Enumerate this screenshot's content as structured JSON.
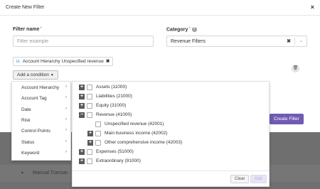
{
  "modal": {
    "title": "Create New Filter",
    "close": "×"
  },
  "form": {
    "filter_name_label": "Filter name",
    "filter_name_placeholder": "Filter example",
    "category_label": "Category",
    "category_value": "Revenue Filters",
    "required_mark": "*",
    "help_icon": "?"
  },
  "chip": {
    "operator": "is",
    "label": "Account Hierarchy Unspecified revenue",
    "remove": "✖"
  },
  "add_condition": "Add a condition",
  "create_button": "Create Filter",
  "condition_menu": [
    {
      "label": "Account Hierarchy"
    },
    {
      "label": "Account Tag"
    },
    {
      "label": "Date"
    },
    {
      "label": "Risk"
    },
    {
      "label": "Control Points"
    },
    {
      "label": "Status"
    },
    {
      "label": "Keyword"
    }
  ],
  "tree": [
    {
      "label": "Assets (11000)",
      "toggle": "+",
      "level": 0
    },
    {
      "label": "Liabilities (21000)",
      "toggle": "+",
      "level": 0
    },
    {
      "label": "Equity (31000)",
      "toggle": "+",
      "level": 0
    },
    {
      "label": "Revenue (41000)",
      "toggle": "−",
      "level": 0
    },
    {
      "label": "Unspecified revenue (42001)",
      "toggle": "",
      "level": 1
    },
    {
      "label": "Main business income (42002)",
      "toggle": "+",
      "level": 1
    },
    {
      "label": "Other comprehensive income (42003)",
      "toggle": "+",
      "level": 1
    },
    {
      "label": "Expenses (51000)",
      "toggle": "+",
      "level": 0
    },
    {
      "label": "Extraordinary (91000)",
      "toggle": "+",
      "level": 0
    }
  ],
  "tree_footer": {
    "clear": "Clear",
    "add": "Add"
  },
  "background": {
    "row_label": "Manual Transac"
  },
  "colors": {
    "accent": "#6f5bb4",
    "link": "#3a87c8",
    "required": "#d9534f"
  }
}
